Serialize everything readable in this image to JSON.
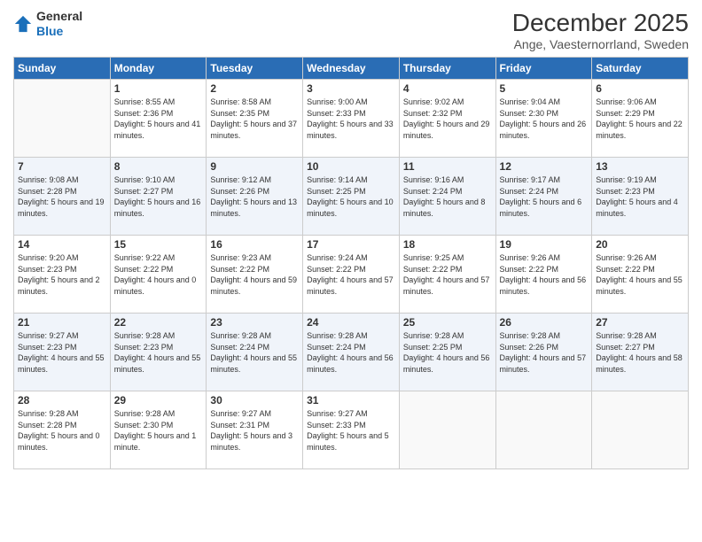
{
  "logo": {
    "general": "General",
    "blue": "Blue"
  },
  "header": {
    "title": "December 2025",
    "subtitle": "Ange, Vaesternorrland, Sweden"
  },
  "weekdays": [
    "Sunday",
    "Monday",
    "Tuesday",
    "Wednesday",
    "Thursday",
    "Friday",
    "Saturday"
  ],
  "weeks": [
    [
      {
        "day": "",
        "sunrise": "",
        "sunset": "",
        "daylight": ""
      },
      {
        "day": "1",
        "sunrise": "Sunrise: 8:55 AM",
        "sunset": "Sunset: 2:36 PM",
        "daylight": "Daylight: 5 hours and 41 minutes."
      },
      {
        "day": "2",
        "sunrise": "Sunrise: 8:58 AM",
        "sunset": "Sunset: 2:35 PM",
        "daylight": "Daylight: 5 hours and 37 minutes."
      },
      {
        "day": "3",
        "sunrise": "Sunrise: 9:00 AM",
        "sunset": "Sunset: 2:33 PM",
        "daylight": "Daylight: 5 hours and 33 minutes."
      },
      {
        "day": "4",
        "sunrise": "Sunrise: 9:02 AM",
        "sunset": "Sunset: 2:32 PM",
        "daylight": "Daylight: 5 hours and 29 minutes."
      },
      {
        "day": "5",
        "sunrise": "Sunrise: 9:04 AM",
        "sunset": "Sunset: 2:30 PM",
        "daylight": "Daylight: 5 hours and 26 minutes."
      },
      {
        "day": "6",
        "sunrise": "Sunrise: 9:06 AM",
        "sunset": "Sunset: 2:29 PM",
        "daylight": "Daylight: 5 hours and 22 minutes."
      }
    ],
    [
      {
        "day": "7",
        "sunrise": "Sunrise: 9:08 AM",
        "sunset": "Sunset: 2:28 PM",
        "daylight": "Daylight: 5 hours and 19 minutes."
      },
      {
        "day": "8",
        "sunrise": "Sunrise: 9:10 AM",
        "sunset": "Sunset: 2:27 PM",
        "daylight": "Daylight: 5 hours and 16 minutes."
      },
      {
        "day": "9",
        "sunrise": "Sunrise: 9:12 AM",
        "sunset": "Sunset: 2:26 PM",
        "daylight": "Daylight: 5 hours and 13 minutes."
      },
      {
        "day": "10",
        "sunrise": "Sunrise: 9:14 AM",
        "sunset": "Sunset: 2:25 PM",
        "daylight": "Daylight: 5 hours and 10 minutes."
      },
      {
        "day": "11",
        "sunrise": "Sunrise: 9:16 AM",
        "sunset": "Sunset: 2:24 PM",
        "daylight": "Daylight: 5 hours and 8 minutes."
      },
      {
        "day": "12",
        "sunrise": "Sunrise: 9:17 AM",
        "sunset": "Sunset: 2:24 PM",
        "daylight": "Daylight: 5 hours and 6 minutes."
      },
      {
        "day": "13",
        "sunrise": "Sunrise: 9:19 AM",
        "sunset": "Sunset: 2:23 PM",
        "daylight": "Daylight: 5 hours and 4 minutes."
      }
    ],
    [
      {
        "day": "14",
        "sunrise": "Sunrise: 9:20 AM",
        "sunset": "Sunset: 2:23 PM",
        "daylight": "Daylight: 5 hours and 2 minutes."
      },
      {
        "day": "15",
        "sunrise": "Sunrise: 9:22 AM",
        "sunset": "Sunset: 2:22 PM",
        "daylight": "Daylight: 4 hours and 0 minutes."
      },
      {
        "day": "16",
        "sunrise": "Sunrise: 9:23 AM",
        "sunset": "Sunset: 2:22 PM",
        "daylight": "Daylight: 4 hours and 59 minutes."
      },
      {
        "day": "17",
        "sunrise": "Sunrise: 9:24 AM",
        "sunset": "Sunset: 2:22 PM",
        "daylight": "Daylight: 4 hours and 57 minutes."
      },
      {
        "day": "18",
        "sunrise": "Sunrise: 9:25 AM",
        "sunset": "Sunset: 2:22 PM",
        "daylight": "Daylight: 4 hours and 57 minutes."
      },
      {
        "day": "19",
        "sunrise": "Sunrise: 9:26 AM",
        "sunset": "Sunset: 2:22 PM",
        "daylight": "Daylight: 4 hours and 56 minutes."
      },
      {
        "day": "20",
        "sunrise": "Sunrise: 9:26 AM",
        "sunset": "Sunset: 2:22 PM",
        "daylight": "Daylight: 4 hours and 55 minutes."
      }
    ],
    [
      {
        "day": "21",
        "sunrise": "Sunrise: 9:27 AM",
        "sunset": "Sunset: 2:23 PM",
        "daylight": "Daylight: 4 hours and 55 minutes."
      },
      {
        "day": "22",
        "sunrise": "Sunrise: 9:28 AM",
        "sunset": "Sunset: 2:23 PM",
        "daylight": "Daylight: 4 hours and 55 minutes."
      },
      {
        "day": "23",
        "sunrise": "Sunrise: 9:28 AM",
        "sunset": "Sunset: 2:24 PM",
        "daylight": "Daylight: 4 hours and 55 minutes."
      },
      {
        "day": "24",
        "sunrise": "Sunrise: 9:28 AM",
        "sunset": "Sunset: 2:24 PM",
        "daylight": "Daylight: 4 hours and 56 minutes."
      },
      {
        "day": "25",
        "sunrise": "Sunrise: 9:28 AM",
        "sunset": "Sunset: 2:25 PM",
        "daylight": "Daylight: 4 hours and 56 minutes."
      },
      {
        "day": "26",
        "sunrise": "Sunrise: 9:28 AM",
        "sunset": "Sunset: 2:26 PM",
        "daylight": "Daylight: 4 hours and 57 minutes."
      },
      {
        "day": "27",
        "sunrise": "Sunrise: 9:28 AM",
        "sunset": "Sunset: 2:27 PM",
        "daylight": "Daylight: 4 hours and 58 minutes."
      }
    ],
    [
      {
        "day": "28",
        "sunrise": "Sunrise: 9:28 AM",
        "sunset": "Sunset: 2:28 PM",
        "daylight": "Daylight: 5 hours and 0 minutes."
      },
      {
        "day": "29",
        "sunrise": "Sunrise: 9:28 AM",
        "sunset": "Sunset: 2:30 PM",
        "daylight": "Daylight: 5 hours and 1 minute."
      },
      {
        "day": "30",
        "sunrise": "Sunrise: 9:27 AM",
        "sunset": "Sunset: 2:31 PM",
        "daylight": "Daylight: 5 hours and 3 minutes."
      },
      {
        "day": "31",
        "sunrise": "Sunrise: 9:27 AM",
        "sunset": "Sunset: 2:33 PM",
        "daylight": "Daylight: 5 hours and 5 minutes."
      },
      {
        "day": "",
        "sunrise": "",
        "sunset": "",
        "daylight": ""
      },
      {
        "day": "",
        "sunrise": "",
        "sunset": "",
        "daylight": ""
      },
      {
        "day": "",
        "sunrise": "",
        "sunset": "",
        "daylight": ""
      }
    ]
  ]
}
